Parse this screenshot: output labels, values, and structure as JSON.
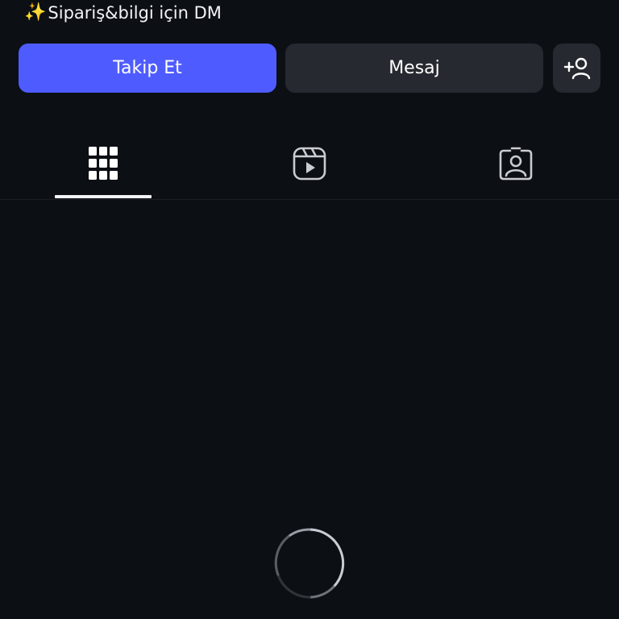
{
  "profile": {
    "bio_icon": "sparkles-icon",
    "bio_text": "Sipariş&bilgi için DM"
  },
  "actions": {
    "follow_label": "Takip Et",
    "message_label": "Mesaj",
    "add_person_icon": "add-person-icon"
  },
  "tabs": [
    {
      "icon": "grid-icon",
      "selected": true
    },
    {
      "icon": "reels-icon",
      "selected": false
    },
    {
      "icon": "tagged-icon",
      "selected": false
    }
  ],
  "content": {
    "state": "loading",
    "loading_icon": "spinner-icon"
  },
  "colors": {
    "background": "#0c0f14",
    "primary_button": "#4e5cff",
    "secondary_button": "#26292f",
    "text": "#f2f4f7",
    "sparkle": "#f5c542"
  }
}
